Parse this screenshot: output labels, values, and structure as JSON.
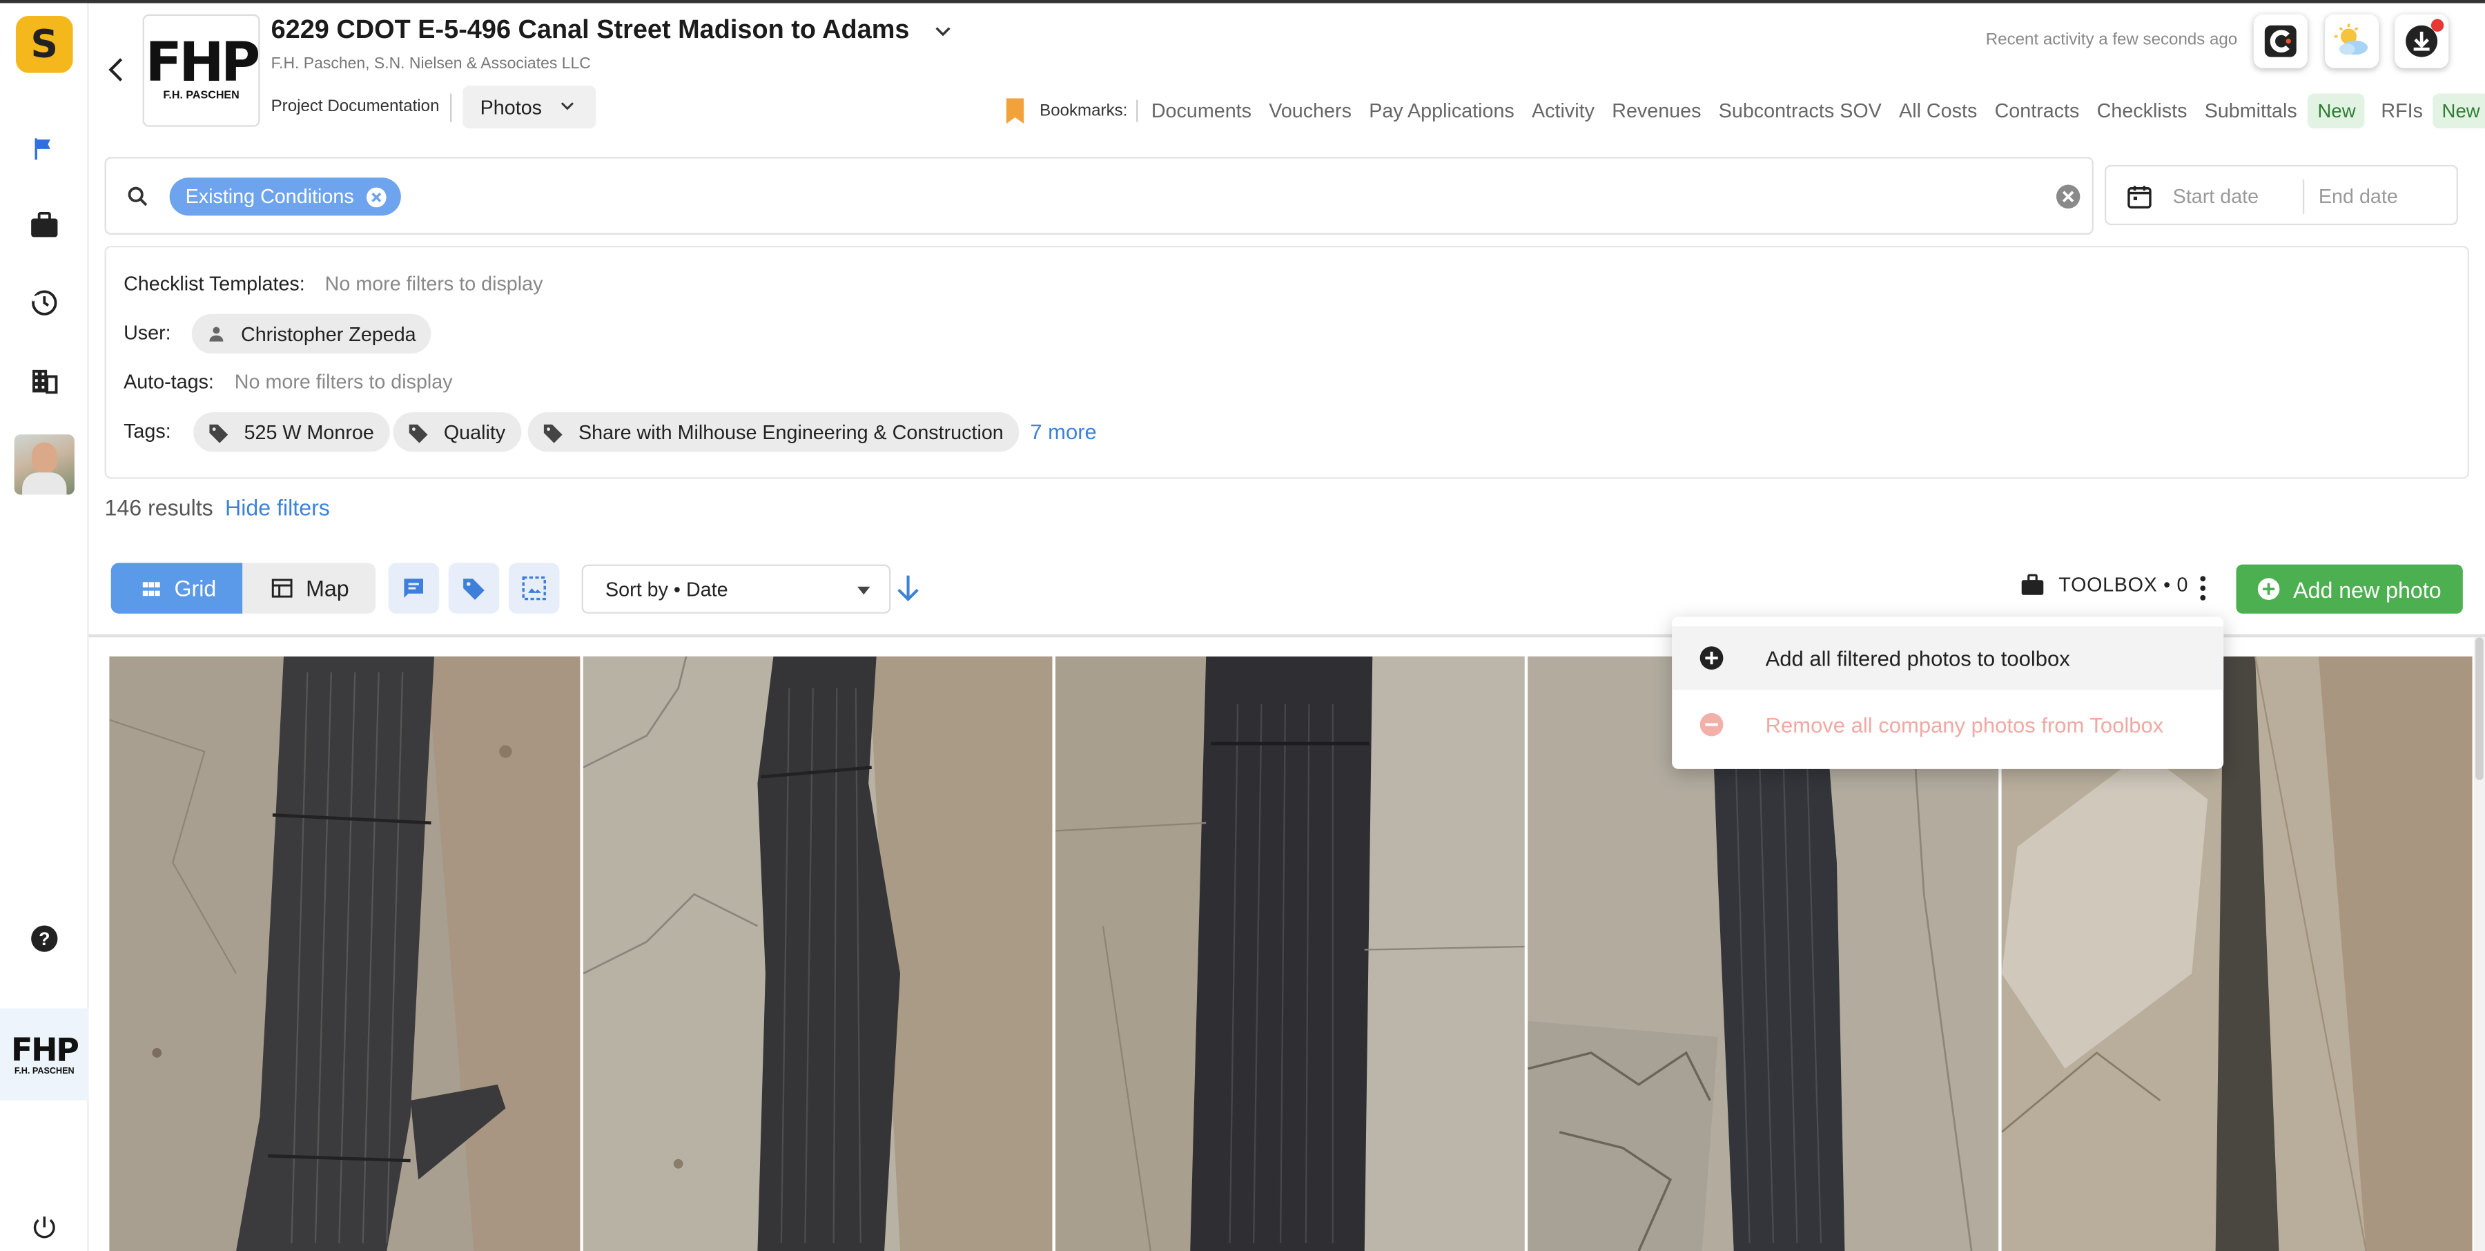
{
  "project": {
    "title": "6229 CDOT E-5-496 Canal Street Madison to Adams",
    "subtitle": "F.H. Paschen, S.N. Nielsen & Associates LLC",
    "section": "Project Documentation",
    "module": "Photos",
    "recent_activity": "Recent activity a few seconds ago"
  },
  "company": {
    "logo_text": "FHP",
    "logo_sub": "F.H. PASCHEN"
  },
  "nav": {
    "bookmarks_label": "Bookmarks:",
    "links": [
      "Documents",
      "Vouchers",
      "Pay Applications",
      "Activity",
      "Revenues",
      "Subcontracts SOV",
      "All Costs",
      "Contracts",
      "Checklists",
      "Submittals"
    ],
    "submittals_badge": "New",
    "rfis": "RFIs",
    "rfis_badge": "New"
  },
  "search": {
    "chip": "Existing Conditions",
    "date_start_placeholder": "Start date",
    "date_end_placeholder": "End date"
  },
  "filters": {
    "checklist_label": "Checklist Templates:",
    "checklist_value": "No more filters to display",
    "user_label": "User:",
    "user_value": "Christopher Zepeda",
    "autotags_label": "Auto-tags:",
    "autotags_value": "No more filters to display",
    "tags_label": "Tags:",
    "tags": [
      "525 W Monroe",
      "Quality",
      "Share with Milhouse Engineering & Construction"
    ],
    "more": "7 more"
  },
  "results": {
    "count": "146 results",
    "hide_filters": "Hide filters"
  },
  "toolbar": {
    "grid": "Grid",
    "map": "Map",
    "sort": "Sort by • Date",
    "toolbox": "TOOLBOX • 0",
    "add_photo": "Add new photo"
  },
  "menu": {
    "add_all": "Add all filtered photos to toolbox",
    "remove_all": "Remove all company photos from Toolbox"
  },
  "colors": {
    "accent": "#5b9ae9",
    "brand": "#f5b81c",
    "success": "#4caf50",
    "danger": "#e57373"
  },
  "icons": [
    "flag-icon",
    "briefcase-icon",
    "history-icon",
    "building-icon",
    "help-icon",
    "power-icon",
    "search-icon",
    "calendar-icon",
    "tag-icon",
    "person-icon",
    "comment-icon",
    "select-icon",
    "plus-circle-icon",
    "minus-circle-icon"
  ]
}
